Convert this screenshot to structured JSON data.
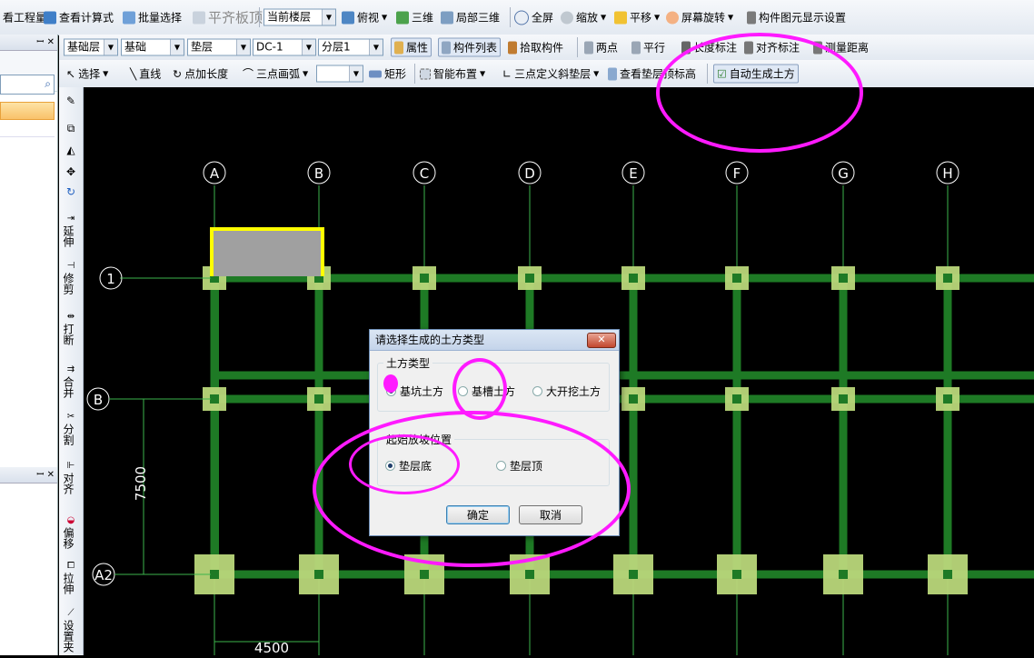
{
  "toolbar1": {
    "items": [
      "看工程量",
      "查看计算式",
      "批量选择",
      "平齐板顶",
      "俯视",
      "三维",
      "局部三维",
      "全屏",
      "缩放",
      "平移",
      "屏幕旋转",
      "构件图元显示设置"
    ],
    "floor_combo": "当前楼层"
  },
  "toolbar2": {
    "combos": [
      "基础层",
      "基础",
      "垫层",
      "DC-1",
      "分层1"
    ],
    "items": [
      "属性",
      "构件列表",
      "拾取构件",
      "两点",
      "平行",
      "长度标注",
      "对齐标注",
      "测量距离"
    ]
  },
  "toolbar3": {
    "items": [
      "选择",
      "直线",
      "点加长度",
      "三点画弧",
      "矩形",
      "智能布置",
      "三点定义斜垫层",
      "查看垫层顶标高",
      "自动生成土方"
    ]
  },
  "left_panel": {
    "close_glyph": "✕",
    "pin_glyph": "ꟷ"
  },
  "vertical_tools": [
    "延伸",
    "修剪",
    "打断",
    "合并",
    "分割",
    "对齐",
    "偏移",
    "拉伸",
    "设置夹"
  ],
  "axes": {
    "columns": [
      "A",
      "B",
      "C",
      "D",
      "E",
      "F",
      "G",
      "H"
    ],
    "rows": [
      "1",
      "B",
      "A2"
    ],
    "dim_vertical": "7500",
    "dim_horizontal": "4500"
  },
  "dialog": {
    "title": "请选择生成的土方类型",
    "group1_title": "土方类型",
    "options1": [
      "基坑土方",
      "基槽土方",
      "大开挖土方"
    ],
    "selected1": 0,
    "group2_title": "起始放坡位置",
    "options2": [
      "垫层底",
      "垫层顶"
    ],
    "selected2": 0,
    "ok": "确定",
    "cancel": "取消"
  },
  "colors": {
    "beam": "#1e7a25",
    "footing": "#b9d77a",
    "column_gray": "#a0a0a0",
    "highlight": "#ffff00",
    "annotation": "#ff1aff",
    "axis_line": "#3cb44b"
  }
}
